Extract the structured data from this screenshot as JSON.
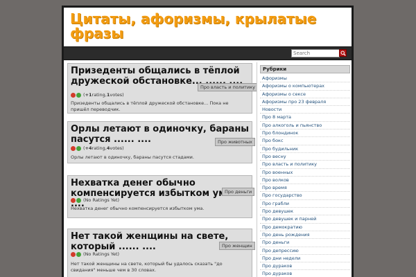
{
  "site": {
    "title": "Цитаты, афоризмы, крылатые фразы"
  },
  "search": {
    "placeholder": "Search"
  },
  "posts": [
    {
      "title": "Призеденты общались в тёплой дружеской обстановке... ...... ....",
      "category": "Про власть и политику",
      "rating_score": "+1",
      "rating_word": " rating, ",
      "rating_votes": "1",
      "rating_suffix": " votes)",
      "excerpt": "Призеденты общались в тёплой дружеской обстановке... Пока не пришёл переводчик."
    },
    {
      "title": "Орлы летают в одиночку, бараны пасутся ...... ....",
      "category": "Про животных",
      "rating_score": "+4",
      "rating_word": " rating, ",
      "rating_votes": "4",
      "rating_suffix": " votes)",
      "excerpt": "Орлы летают в одиночку, бараны пасутся стадами."
    },
    {
      "title": "Нехватка денег обычно компенсируется избытком ума.... ....",
      "category": "Про деньги",
      "rating_text": "(No Ratings Yet)",
      "excerpt": "Нехватка денег обычно компенсируется избытком ума."
    },
    {
      "title": "Нет такой женщины на свете, который ...... ....",
      "category": "Про женщин",
      "rating_text": "(No Ratings Yet)",
      "excerpt": "Нет такой женщины на свете, который бы удалось сказать \"до свидания\" меньше чем в 30 словах."
    }
  ],
  "sidebar": {
    "heading": "Рубрики",
    "items": [
      "Афоризмы",
      "Афоризмы о компьютерах",
      "Афоризмы о сексе",
      "Афоризмы про 23 февраля",
      "Новости",
      "Про 8 марта",
      "Про алкоголь и пьянство",
      "Про блондинок",
      "Про бокс",
      "Про будильник",
      "Про весну",
      "Про власть и политику",
      "Про военных",
      "Про волков",
      "Про время",
      "Про государство",
      "Про грабли",
      "Про девушек",
      "Про девушек и парней",
      "Про демократию",
      "Про день рождения",
      "Про деньги",
      "Про депрессию",
      "Про дни недели",
      "Про дураков",
      "Про дураков"
    ]
  },
  "icons": {
    "search": "search-icon",
    "thumb_down": "thumb-down-icon",
    "thumb_up": "thumb-up-icon"
  }
}
